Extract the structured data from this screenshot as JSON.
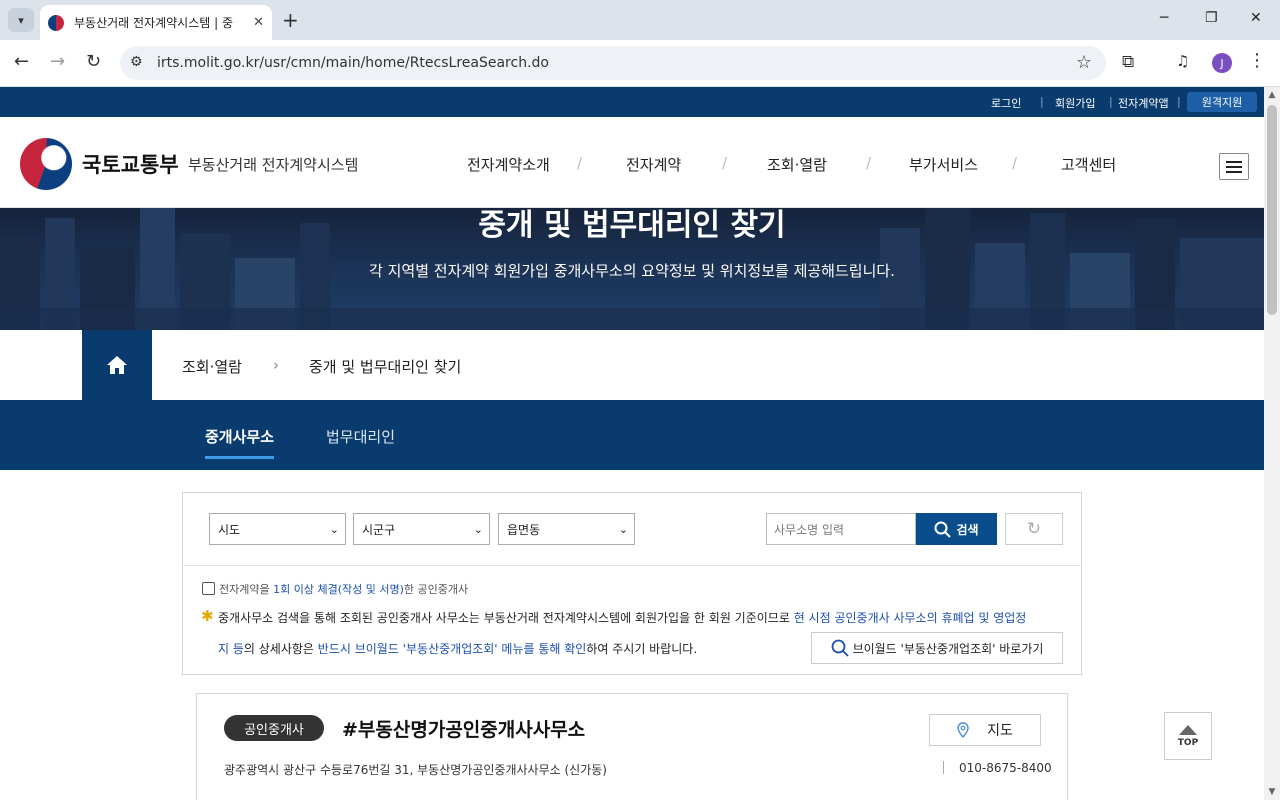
{
  "browser": {
    "tab_title": "부동산거래 전자계약시스템 | 중",
    "new_tab": "+",
    "url": "irts.molit.go.kr/usr/cmn/main/home/RtecsLreaSearch.do",
    "avatar": "J"
  },
  "util_menu": {
    "login": "로그인",
    "signup": "회원가입",
    "econtract_app": "전자계약앱",
    "remote_support": "원격지원"
  },
  "header": {
    "ministry": "국토교통부",
    "system_name": "부동산거래 전자계약시스템",
    "menu": [
      "전자계약소개",
      "전자계약",
      "조회·열람",
      "부가서비스",
      "고객센터"
    ],
    "menu_sep": "/"
  },
  "hero": {
    "title": "중개 및 법무대리인 찾기",
    "subtitle": "각 지역별 전자계약 회원가입 중개사무소의 요약정보 및 위치정보를 제공해드립니다."
  },
  "breadcrumb": {
    "level1": "조회·열람",
    "sep": "›",
    "level2": "중개 및 법무대리인 찾기"
  },
  "subtabs": {
    "broker": "중개사무소",
    "legal": "법무대리인"
  },
  "search": {
    "sido": "시도",
    "sigungu": "시군구",
    "eupmyeondong": "읍면동",
    "name_placeholder": "사무소명 입력",
    "search_label": "검색",
    "checkbox_pre": "전자계약을 ",
    "checkbox_highlight": "1회 이상 체결(작성 및 서명)",
    "checkbox_post": "한 공인중개사",
    "notice_a": "중개사무소 검색을 통해 조회된 공인중개사 사무소는 부동산거래 전자계약시스템에 회원가입을 한 회원 기준이므로 ",
    "notice_b": "현 시점 공인중개사 사무소의 휴폐업 및 영업정",
    "notice_c": "지 등",
    "notice_d": "의 상세사항은 ",
    "notice_e": "반드시 브이월드 '부동산중개업조회' 메뉴를 통해 확인",
    "notice_f": "하여 주시기 바랍니다.",
    "vworld_button": "브이월드 '부동산중개업조회' 바로가기"
  },
  "result": {
    "badge": "공인중개사",
    "name": "#부동산명가공인중개사사무소",
    "map_button": "지도",
    "address": "광주광역시 광산구 수등로76번길 31, 부동산명가공인중개사사무소 (신가동)",
    "phone": "010-8675-8400"
  },
  "top_button": "TOP",
  "colors": {
    "navy": "#0a3b6e",
    "accent_blue": "#1d4fb0",
    "tab_underline": "#3e9be8",
    "star": "#e4a800"
  }
}
